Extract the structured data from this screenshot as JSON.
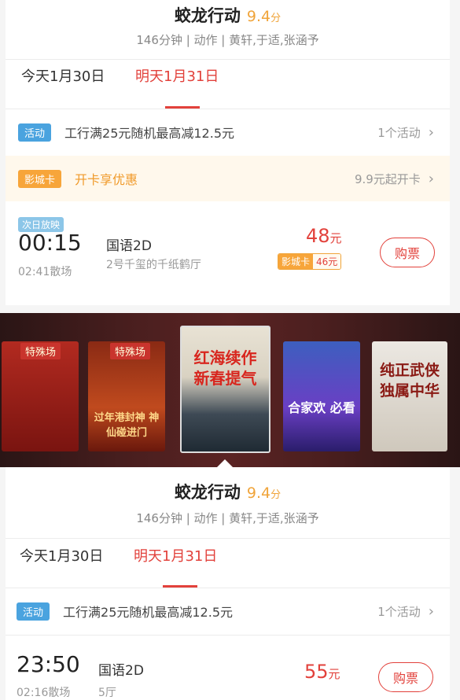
{
  "section1": {
    "title": "蛟龙行动",
    "score": "9.4",
    "score_unit": "分",
    "meta": "146分钟 | 动作 | 黄轩,于适,张涵予",
    "tabs": [
      "今天1月30日",
      "明天1月31日"
    ],
    "promo": {
      "tag": "活动",
      "text": "工行满25元随机最高减12.5元",
      "right": "1个活动"
    },
    "card": {
      "tag": "影城卡",
      "text": "开卡享优惠",
      "right": "9.9元起开卡"
    },
    "show": {
      "next_day_badge": "次日放映",
      "time": "00:15",
      "end": "02:41散场",
      "lang": "国语2D",
      "hall": "2号千玺的千纸鹤厅",
      "price": "48",
      "price_unit": "元",
      "member_label": "影城卡",
      "member_price": "46元",
      "buy": "购票"
    }
  },
  "carousel": {
    "posters": [
      {
        "badge": "特殊场",
        "text": ""
      },
      {
        "badge": "特殊场",
        "text": "过年港封神 神仙碰进门"
      },
      {
        "badge": "",
        "text": "红海续作 新春提气"
      },
      {
        "badge": "",
        "text": "合家欢 必看"
      },
      {
        "badge": "",
        "text": "纯正武侠 独属中华"
      }
    ]
  },
  "section2": {
    "title": "蛟龙行动",
    "score": "9.4",
    "score_unit": "分",
    "meta": "146分钟 | 动作 | 黄轩,于适,张涵予",
    "tabs": [
      "今天1月30日",
      "明天1月31日"
    ],
    "promo": {
      "tag": "活动",
      "text": "工行满25元随机最高减12.5元",
      "right": "1个活动"
    },
    "show": {
      "time": "23:50",
      "end": "02:16散场",
      "lang": "国语2D",
      "hall": "5厅",
      "price": "55",
      "price_unit": "元",
      "buy": "购票"
    }
  },
  "colors": {
    "accent": "#e2413b",
    "score": "#f0a43a",
    "tag_blue": "#4aa3df",
    "tag_orange": "#f7a53a"
  }
}
